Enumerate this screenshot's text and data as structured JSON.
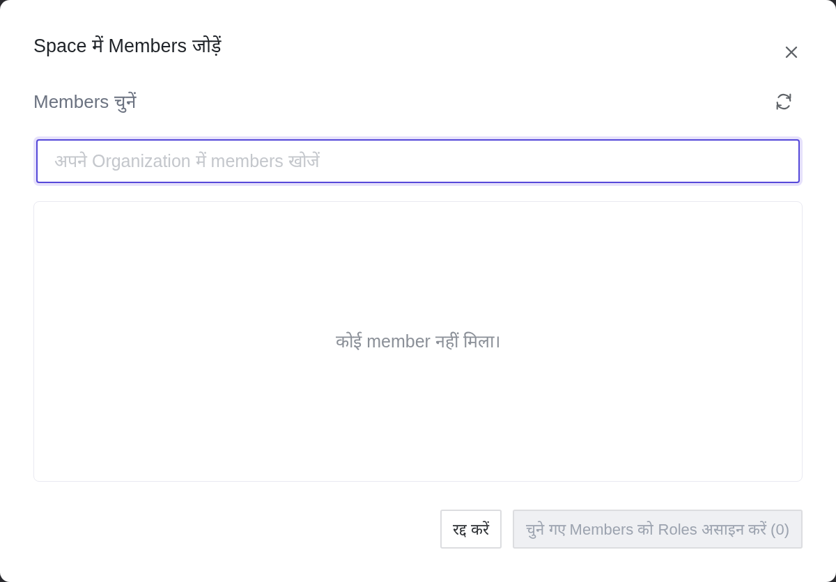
{
  "dialog": {
    "title": "Space में Members जोड़ें",
    "section_label": "Members चुनें",
    "search": {
      "placeholder": "अपने Organization में members खोजें",
      "focused": true
    },
    "empty_message": "कोई member नहीं मिला।",
    "buttons": [
      {
        "label": "रद्द करें",
        "kind": "secondary",
        "disabled": false
      },
      {
        "label": "चुने गए Members को Roles असाइन करें (0)",
        "kind": "primary",
        "disabled": true
      }
    ]
  }
}
